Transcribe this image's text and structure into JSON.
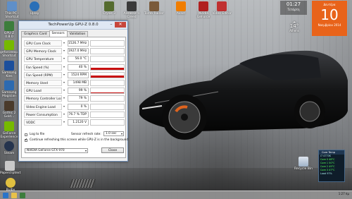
{
  "desktop": {
    "icons": [
      {
        "label": "This PC - Shortcut",
        "color": "#5f8fc8"
      },
      {
        "label": "Uplay",
        "color": "#2a6fb7"
      },
      {
        "label": "GPU-Z 0.8.0",
        "color": "#3c7d3c"
      },
      {
        "label": "geforceexp... Shortcut",
        "color": "#76b900"
      },
      {
        "label": "Samsung Kies",
        "color": "#1c4f9c"
      },
      {
        "label": "Samsung Magician",
        "color": "#2c6ab0"
      },
      {
        "label": "Gothic 2 Gold...",
        "color": "#4a3a2a"
      },
      {
        "label": "GeForce Experience",
        "color": "#76b900"
      },
      {
        "label": "Steam",
        "color": "#25344e"
      },
      {
        "label": "Papercliptext",
        "color": "#c9c9c9"
      },
      {
        "label": "Bulby",
        "color": "#e0c040"
      }
    ],
    "top_icons": [
      {
        "label": "Crysis 3",
        "color": "#556b2f"
      },
      {
        "label": "Assassin's Creed",
        "color": "#3a3a3a"
      },
      {
        "label": "Tomb Raider",
        "color": "#7a5a3a"
      },
      {
        "label": "Avast",
        "color": "#f07d00"
      },
      {
        "label": "Nvidia GeForce",
        "color": "#b02020"
      },
      {
        "label": "Video Editor",
        "color": "#c03030"
      }
    ],
    "recycle_bin_label": "Recycle Bin"
  },
  "gpuz": {
    "title": "TechPowerUp GPU-Z 0.8.0",
    "tabs": [
      "Graphics Card",
      "Sensors",
      "Validation"
    ],
    "active_tab": "Sensors",
    "sensors": [
      {
        "label": "GPU Core Clock",
        "value": "1526.7 MHz",
        "graph": 0.0
      },
      {
        "label": "GPU Memory Clock",
        "value": "1927.0 MHz",
        "graph": 0.0
      },
      {
        "label": "GPU Temperature",
        "value": "56.0 °C",
        "graph": 0.0
      },
      {
        "label": "Fan Speed (%)",
        "value": "40 %",
        "graph": 0.42
      },
      {
        "label": "Fan Speed (RPM)",
        "value": "1524 RPM",
        "graph": 0.42
      },
      {
        "label": "Memory Used",
        "value": "1498 MB",
        "graph": 0.0
      },
      {
        "label": "GPU Load",
        "value": "99 %",
        "graph": 0.12
      },
      {
        "label": "Memory Controller Load",
        "value": "79 %",
        "graph": 0.0
      },
      {
        "label": "Video Engine Load",
        "value": "0 %",
        "graph": 0.0
      },
      {
        "label": "Power Consumption",
        "value": "76.7 % TDP",
        "graph": 0.0
      },
      {
        "label": "VDDC",
        "value": "1.2120 V",
        "graph": 0.0
      }
    ],
    "log_to_file": "Log to file",
    "refresh_label": "Sensor refresh rate:",
    "refresh_value": "1.0 sec",
    "continue_refresh": "Continue refreshing this screen while GPU-Z is in the background",
    "card": "NVIDIA GeForce GTX 970",
    "close": "Close"
  },
  "clock": {
    "time": "01:27",
    "date": "Τετάρτη",
    "day_number": "10",
    "month_year": "Νοεμβρίου 2014",
    "weekday": "Δευτέρα"
  },
  "weather": {
    "temp": "14°",
    "city": "Athens"
  },
  "coretemp": {
    "title": "Core Temp",
    "lines": [
      "i7 4770K",
      "Core 0   48°C",
      "Core 1   50°C",
      "Core 2   49°C",
      "Core 3   47°C",
      "Load 97%"
    ]
  },
  "taskbar": {
    "tray_time": "1:27 πμ",
    "tray_date": "10/11/2014"
  }
}
